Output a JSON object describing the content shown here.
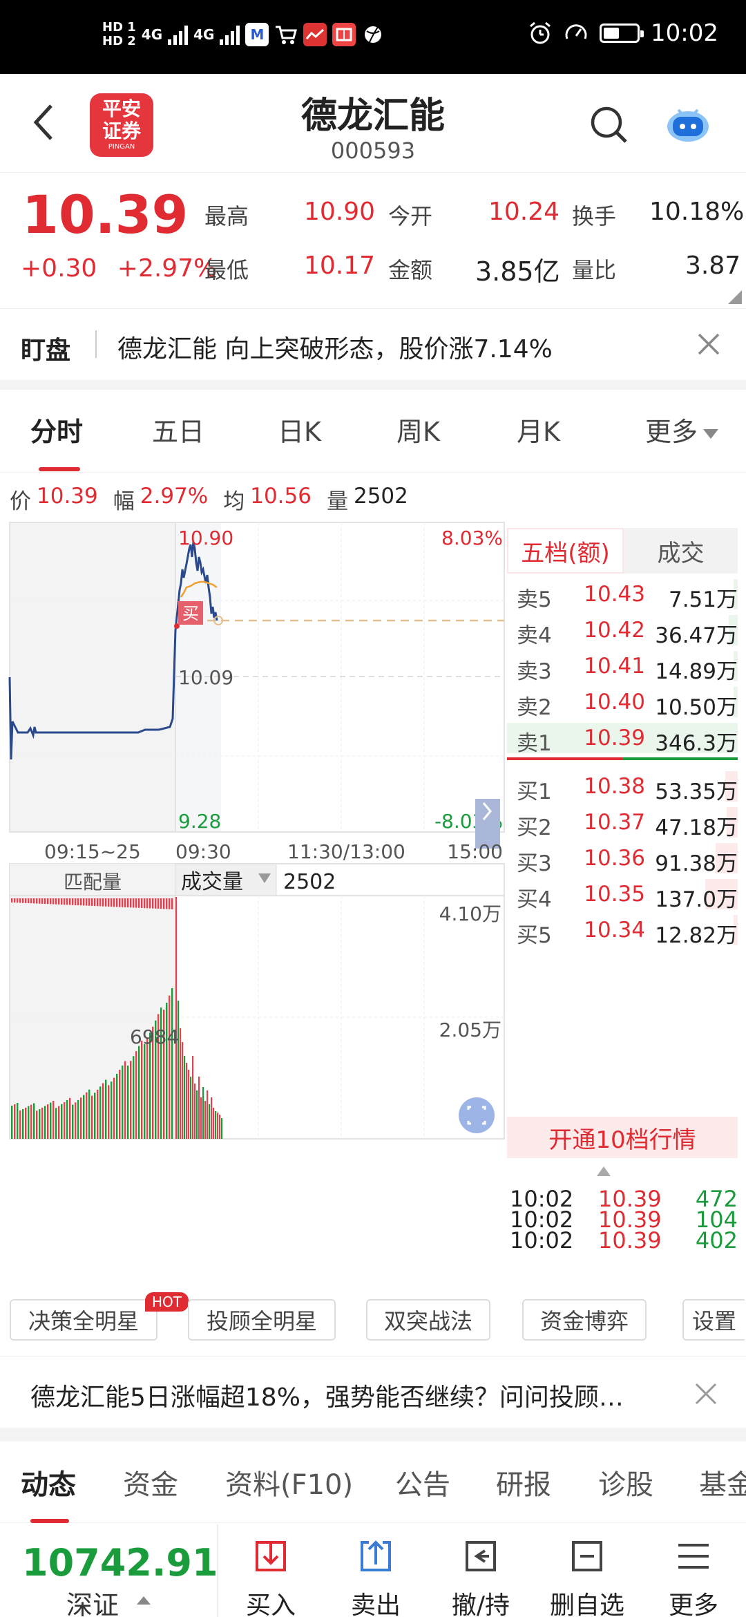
{
  "status": {
    "hd1": "HD 1",
    "hd2": "HD 2",
    "net1": "4G",
    "net2": "4G",
    "time": "10:02"
  },
  "header": {
    "title": "德龙汇能",
    "code": "000593",
    "logo_line1": "平安",
    "logo_line2": "证券",
    "logo_small": "PINGAN"
  },
  "quote": {
    "price": "10.39",
    "change": "+0.30",
    "change_pct": "+2.97%",
    "high_label": "最高",
    "high": "10.90",
    "open_label": "今开",
    "open": "10.24",
    "turnover_label": "换手",
    "turnover": "10.18%",
    "low_label": "最低",
    "low": "10.17",
    "amount_label": "金额",
    "amount": "3.85亿",
    "vol_ratio_label": "量比",
    "vol_ratio": "3.87"
  },
  "alert": {
    "tag": "盯盘",
    "text": "德龙汇能 向上突破形态，股价涨7.14%"
  },
  "tabs": [
    "分时",
    "五日",
    "日K",
    "周K",
    "月K",
    "更多"
  ],
  "infoline": {
    "price_label": "价",
    "price": "10.39",
    "range_label": "幅",
    "range": "2.97%",
    "avg_label": "均",
    "avg": "10.56",
    "vol_label": "量",
    "vol": "2502"
  },
  "chart": {
    "high_label": "10.90",
    "high_pct": "8.03%",
    "mid_label": "10.09",
    "low_label": "9.28",
    "low_pct": "-8.03%",
    "buy_marker": "买",
    "times": [
      "09:15~25",
      "09:30",
      "11:30/13:00",
      "15:00"
    ],
    "vol_tab_match": "匹配量",
    "vol_tab_trade": "成交量",
    "vol_value": "2502",
    "vol_max": "4.10万",
    "vol_mid": "2.05万",
    "vol_peak_label": "6984"
  },
  "orderbook": {
    "tab_active": "五档(额)",
    "tab_trades": "成交",
    "asks": [
      {
        "label": "卖5",
        "price": "10.43",
        "vol": "7.51万"
      },
      {
        "label": "卖4",
        "price": "10.42",
        "vol": "36.47万"
      },
      {
        "label": "卖3",
        "price": "10.41",
        "vol": "14.89万"
      },
      {
        "label": "卖2",
        "price": "10.40",
        "vol": "10.50万"
      },
      {
        "label": "卖1",
        "price": "10.39",
        "vol": "346.3万"
      }
    ],
    "bids": [
      {
        "label": "买1",
        "price": "10.38",
        "vol": "53.35万"
      },
      {
        "label": "买2",
        "price": "10.37",
        "vol": "47.18万"
      },
      {
        "label": "买3",
        "price": "10.36",
        "vol": "91.38万"
      },
      {
        "label": "买4",
        "price": "10.35",
        "vol": "137.0万"
      },
      {
        "label": "买5",
        "price": "10.34",
        "vol": "12.82万"
      }
    ],
    "open10": "开通10档行情",
    "ticks": [
      {
        "time": "10:02",
        "price": "10.39",
        "vol": "472"
      },
      {
        "time": "10:02",
        "price": "10.39",
        "vol": "104"
      },
      {
        "time": "10:02",
        "price": "10.39",
        "vol": "402"
      }
    ]
  },
  "tools": [
    "决策全明星",
    "投顾全明星",
    "双突战法",
    "资金博弈",
    "设置"
  ],
  "tools_hot": "HOT",
  "news": {
    "text": "德龙汇能5日涨幅超18%，强势能否继续？问问投顾…"
  },
  "bottom_tabs": [
    "动态",
    "资金",
    "资料(F10)",
    "公告",
    "研报",
    "诊股",
    "基金"
  ],
  "index": {
    "value": "10742.91",
    "name": "深证"
  },
  "actions": [
    "买入",
    "卖出",
    "撤/持",
    "删自选",
    "更多"
  ],
  "colors": {
    "up": "#e02b33",
    "down": "#1a9c3c",
    "line": "#2a4a8c",
    "avg": "#f0a030"
  }
}
